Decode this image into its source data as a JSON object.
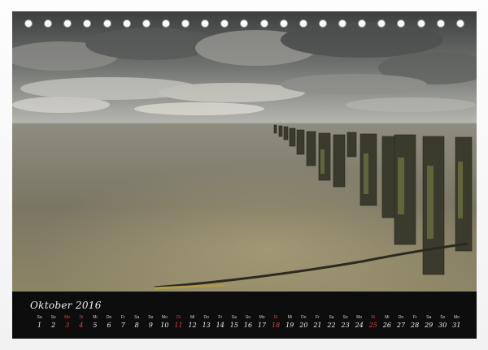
{
  "calendar": {
    "month": "Oktober",
    "year": "2016",
    "days": [
      {
        "wd": "Sa",
        "d": "1",
        "red": false
      },
      {
        "wd": "So",
        "d": "2",
        "red": false
      },
      {
        "wd": "Mo",
        "d": "3",
        "red": true
      },
      {
        "wd": "Di",
        "d": "4",
        "red": true
      },
      {
        "wd": "Mi",
        "d": "5",
        "red": false
      },
      {
        "wd": "Do",
        "d": "6",
        "red": false
      },
      {
        "wd": "Fr",
        "d": "7",
        "red": false
      },
      {
        "wd": "Sa",
        "d": "8",
        "red": false
      },
      {
        "wd": "So",
        "d": "9",
        "red": false
      },
      {
        "wd": "Mo",
        "d": "10",
        "red": false
      },
      {
        "wd": "Di",
        "d": "11",
        "red": true
      },
      {
        "wd": "Mi",
        "d": "12",
        "red": false
      },
      {
        "wd": "Do",
        "d": "13",
        "red": false
      },
      {
        "wd": "Fr",
        "d": "14",
        "red": false
      },
      {
        "wd": "Sa",
        "d": "15",
        "red": false
      },
      {
        "wd": "So",
        "d": "16",
        "red": false
      },
      {
        "wd": "Mo",
        "d": "17",
        "red": false
      },
      {
        "wd": "Di",
        "d": "18",
        "red": true
      },
      {
        "wd": "Mi",
        "d": "19",
        "red": false
      },
      {
        "wd": "Do",
        "d": "20",
        "red": false
      },
      {
        "wd": "Fr",
        "d": "21",
        "red": false
      },
      {
        "wd": "Sa",
        "d": "22",
        "red": false
      },
      {
        "wd": "So",
        "d": "23",
        "red": false
      },
      {
        "wd": "Mo",
        "d": "24",
        "red": false
      },
      {
        "wd": "Di",
        "d": "25",
        "red": true
      },
      {
        "wd": "Mi",
        "d": "26",
        "red": false
      },
      {
        "wd": "Do",
        "d": "27",
        "red": false
      },
      {
        "wd": "Fr",
        "d": "28",
        "red": false
      },
      {
        "wd": "Sa",
        "d": "29",
        "red": false
      },
      {
        "wd": "So",
        "d": "30",
        "red": false
      },
      {
        "wd": "Mo",
        "d": "31",
        "red": false
      }
    ]
  },
  "colors": {
    "calendar_bar": "#0d0d0d",
    "highlight_red": "#e04545"
  }
}
